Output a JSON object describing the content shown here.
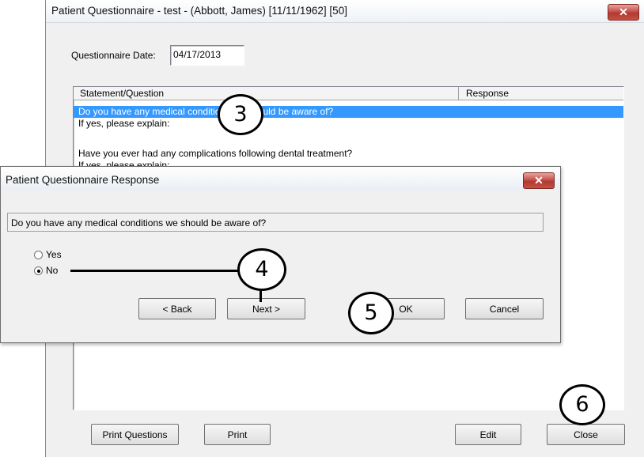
{
  "main_window": {
    "title": "Patient Questionnaire - test - (Abbott, James) [11/11/1962] [50]",
    "close_glyph": "✕",
    "questionnaire_date_label": "Questionnaire Date:",
    "questionnaire_date_value": "04/17/2013",
    "list": {
      "columns": [
        "Statement/Question",
        "Response"
      ],
      "rows": [
        "Do you have any medical conditions we should be aware of?",
        "If yes, please explain:",
        "",
        "Have you ever had any complications following dental treatment?",
        "If yes, please explain:"
      ],
      "selected_row": 0
    },
    "buttons": {
      "print_questions": "Print Questions",
      "print": "Print",
      "edit": "Edit",
      "close": "Close"
    }
  },
  "dialog": {
    "title": "Patient Questionnaire Response",
    "close_glyph": "✕",
    "question": "Do you have any medical conditions we should be aware of?",
    "options": [
      "Yes",
      "No"
    ],
    "selected_option": "No",
    "buttons": {
      "back": "< Back",
      "next": "Next >",
      "ok": "OK",
      "cancel": "Cancel"
    }
  },
  "callouts": [
    "3",
    "4",
    "5",
    "6"
  ],
  "colors": {
    "selection": "#3399ff",
    "close_button": "#c75050",
    "window_background": "#f0f0f0"
  }
}
